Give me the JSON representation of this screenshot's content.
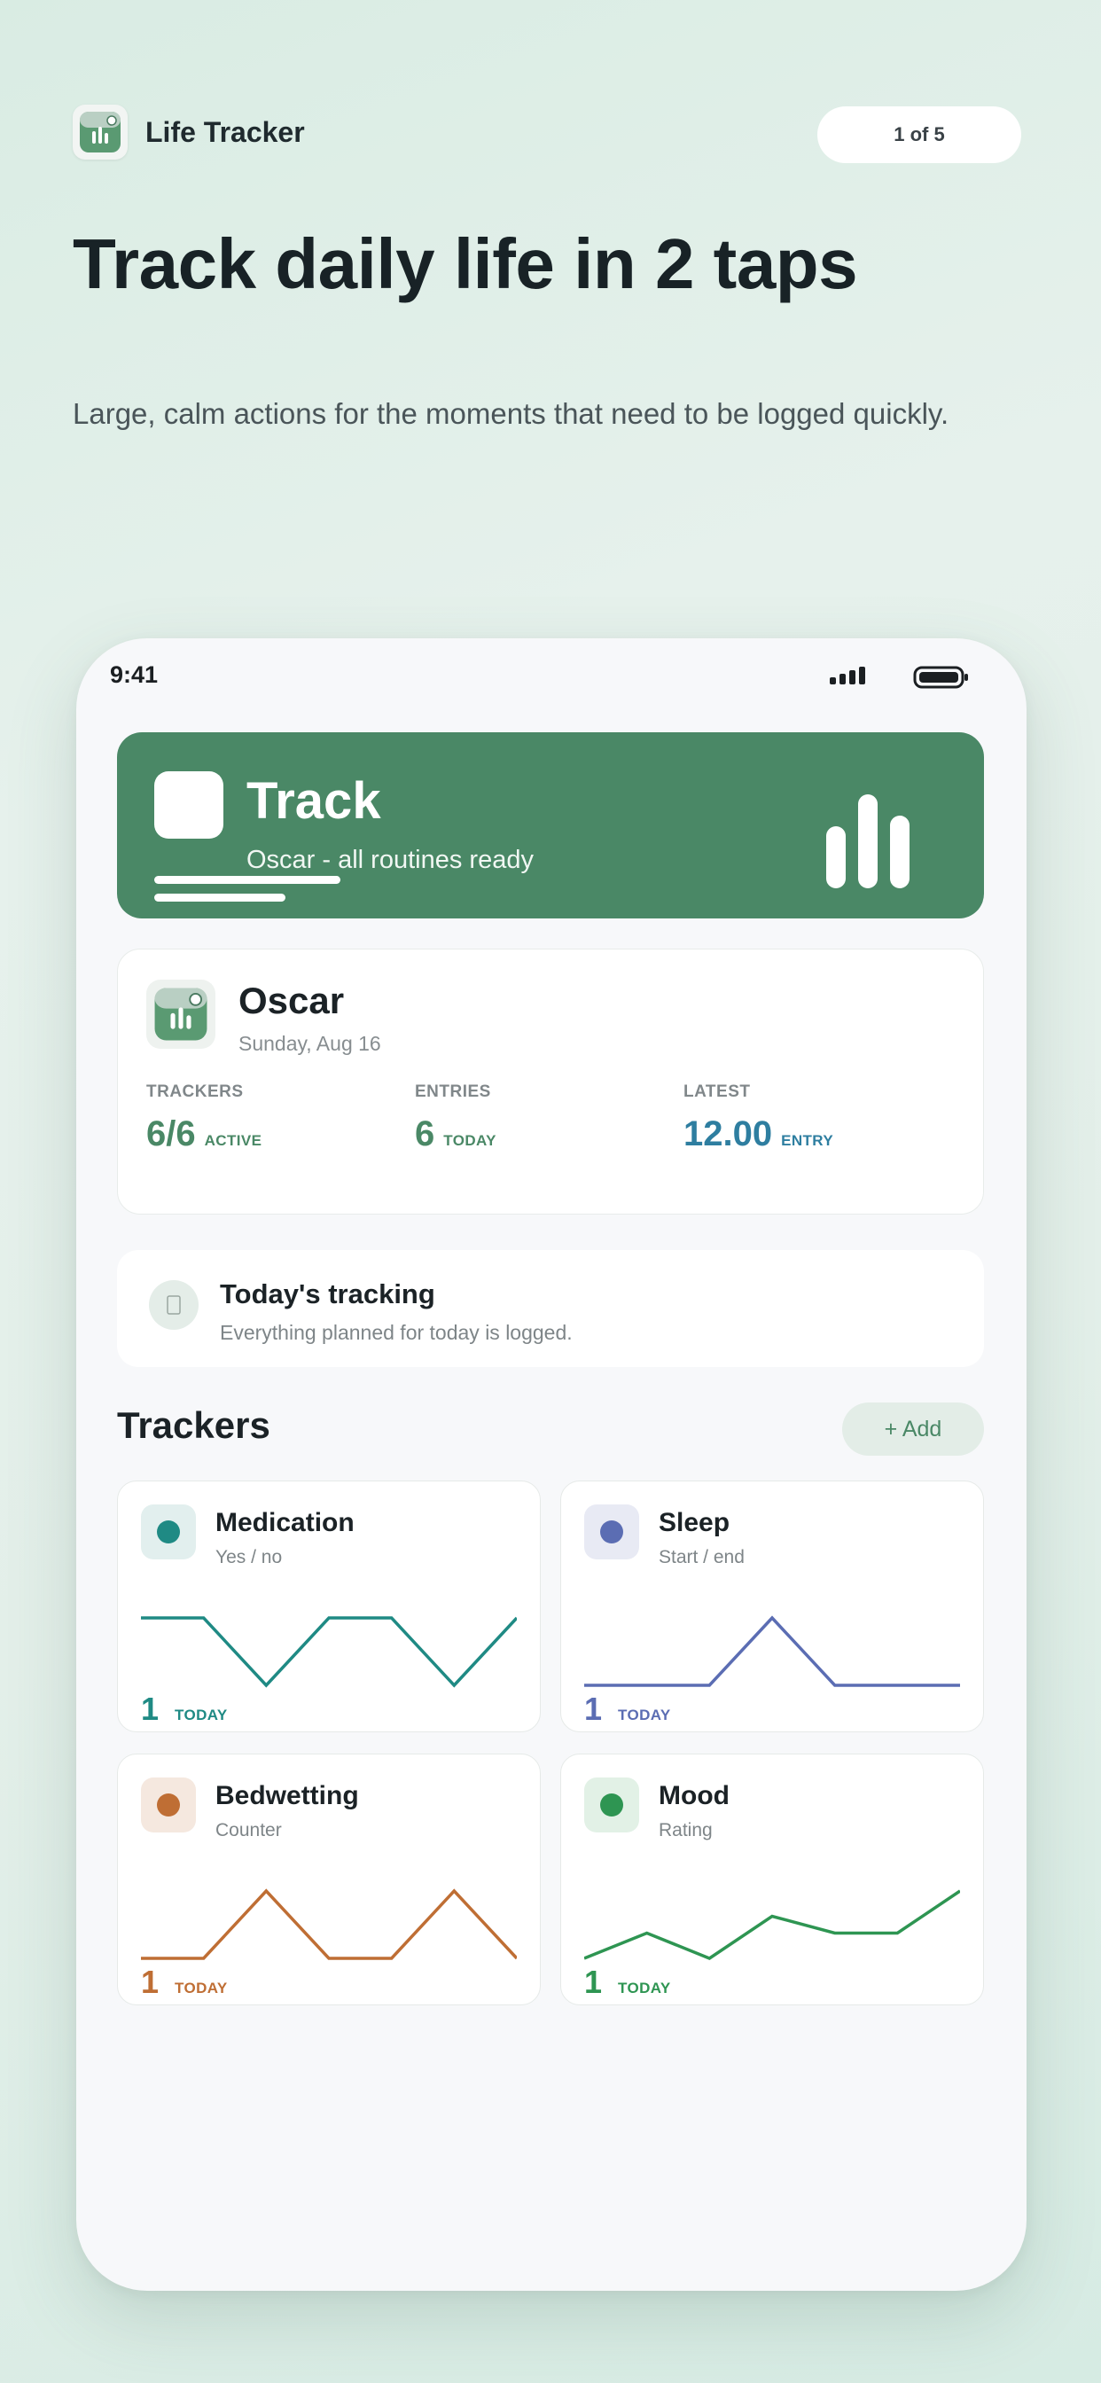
{
  "header": {
    "app_name": "Life Tracker",
    "pager": "1 of 5",
    "headline": "Track daily life in 2 taps",
    "subhead": "Large, calm actions for the moments that need to be logged quickly."
  },
  "status_bar": {
    "time": "9:41"
  },
  "track_card": {
    "title": "Track",
    "subtitle": "Oscar - all routines ready",
    "color": "#4a8866"
  },
  "profile": {
    "name": "Oscar",
    "date": "Sunday, Aug 16",
    "stats": [
      {
        "label": "TRACKERS",
        "value": "6/6",
        "unit": "ACTIVE",
        "color": "#4a8866"
      },
      {
        "label": "ENTRIES",
        "value": "6",
        "unit": "TODAY",
        "color": "#4a8866"
      },
      {
        "label": "LATEST",
        "value": "12.00",
        "unit": "ENTRY",
        "color": "#2e7ea0"
      }
    ]
  },
  "today": {
    "title": "Today's tracking",
    "subtitle": "Everything planned for today is logged."
  },
  "trackers_section": {
    "title": "Trackers",
    "add_label": "+ Add"
  },
  "trackers": [
    {
      "name": "Medication",
      "type": "Yes / no",
      "count": "1",
      "unit": "TODAY",
      "color": "#1f8a84",
      "icon_bg": "#e2efee",
      "series": [
        1,
        1,
        0,
        1,
        1,
        0,
        1
      ]
    },
    {
      "name": "Sleep",
      "type": "Start / end",
      "count": "1",
      "unit": "TODAY",
      "color": "#5b6db3",
      "icon_bg": "#e8eaf4",
      "series": [
        0,
        0,
        0,
        1,
        0,
        0,
        0
      ]
    },
    {
      "name": "Bedwetting",
      "type": "Counter",
      "count": "1",
      "unit": "TODAY",
      "color": "#bf6e34",
      "icon_bg": "#f5e8df",
      "series": [
        0,
        0,
        1,
        0,
        0,
        1,
        0
      ]
    },
    {
      "name": "Mood",
      "type": "Rating",
      "count": "1",
      "unit": "TODAY",
      "color": "#2e9552",
      "icon_bg": "#e2f1e6",
      "series": [
        2,
        2.3,
        2,
        2.5,
        2.3,
        2.3,
        2.8
      ]
    }
  ]
}
